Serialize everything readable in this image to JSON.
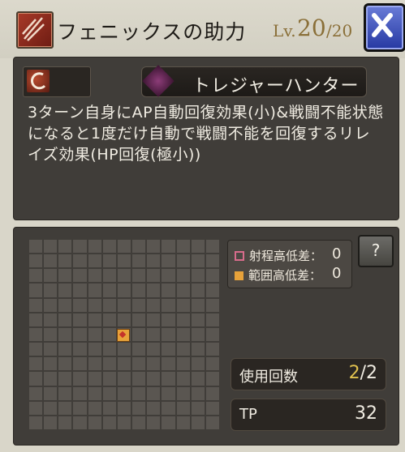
{
  "header": {
    "title": "フェニックスの助力",
    "level_label": "Lv.",
    "level_current": "20",
    "level_max": "/20",
    "close_icon": "close-x-icon"
  },
  "skill": {
    "icon": "skill-slash-icon",
    "weapon_type": "トレジャーハンター",
    "weapon_icon": "treasure-hunter-gem-icon",
    "description": "3ターン自身にAP自動回復効果(小)&戦闘不能状態になると1度だけ自動で戦闘不能を回復するリレイズ効果(HP回復(極小))"
  },
  "range": {
    "range_height_label": "射程高低差：",
    "range_height_value": "0",
    "area_height_label": "範囲高低差：",
    "area_height_value": "0",
    "help_label": "?",
    "colors": {
      "range": "#d86c8c",
      "area": "#e7a23a"
    },
    "grid_size": 13
  },
  "stats": {
    "uses_label": "使用回数",
    "uses_current": "2",
    "uses_max": "/2",
    "tp_label": "TP",
    "tp_value": "32"
  }
}
